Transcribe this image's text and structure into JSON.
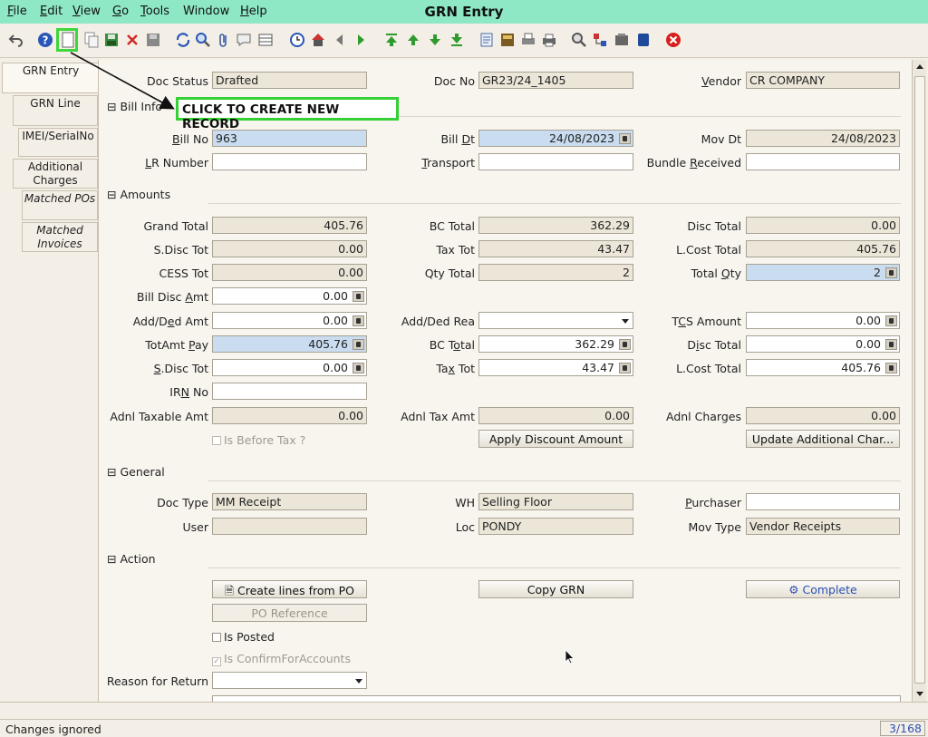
{
  "menu": {
    "items": [
      {
        "label": "File",
        "u": "F",
        "rest": "ile"
      },
      {
        "label": "Edit",
        "u": "E",
        "rest": "dit"
      },
      {
        "label": "View",
        "u": "V",
        "rest": "iew"
      },
      {
        "label": "Go",
        "u": "G",
        "rest": "o"
      },
      {
        "label": "Tools",
        "u": "T",
        "rest": "ools"
      },
      {
        "label": "Window",
        "u": "",
        "rest": "Window"
      },
      {
        "label": "Help",
        "u": "H",
        "rest": "elp"
      }
    ],
    "title": "GRN Entry"
  },
  "annotation": {
    "callout": "CLICK TO CREATE NEW RECORD"
  },
  "tabs": [
    {
      "label": "GRN Entry"
    },
    {
      "label": "GRN Line"
    },
    {
      "label": "IMEI/SerialNo"
    },
    {
      "label": "Additional Charges"
    },
    {
      "label": "Matched POs"
    },
    {
      "label": "Matched Invoices"
    }
  ],
  "header": {
    "doc_status_label": "Doc Status",
    "doc_status": "Drafted",
    "doc_no_label": "Doc No",
    "doc_no": "GR23/24_1405",
    "vendor_label_u": "V",
    "vendor_label_rest": "endor",
    "vendor": "CR COMPANY"
  },
  "bill_info": {
    "title": "Bill Info",
    "bill_no_label_u": "B",
    "bill_no_label_rest": "ill No",
    "bill_no": "963",
    "bill_dt_label_pre": "Bill ",
    "bill_dt_label_u": "D",
    "bill_dt_label_rest": "t",
    "bill_dt": "24/08/2023",
    "mov_dt_label": "Mov Dt",
    "mov_dt": "24/08/2023",
    "lr_label_u": "L",
    "lr_label_rest": "R Number",
    "lr_number": "",
    "transport_label_u": "T",
    "transport_label_rest": "ransport",
    "transport": "",
    "bundle_label_pre": "Bundle ",
    "bundle_label_u": "R",
    "bundle_label_rest": "eceived",
    "bundle_received": ""
  },
  "amounts": {
    "title": "Amounts",
    "grand_total_label": "Grand Total",
    "grand_total": "405.76",
    "bc_total_label": "BC Total",
    "bc_total": "362.29",
    "disc_total_label": "Disc Total",
    "disc_total": "0.00",
    "sdisc_tot_label": "S.Disc Tot",
    "sdisc_tot": "0.00",
    "tax_tot_label": "Tax Tot",
    "tax_tot": "43.47",
    "lcost_total_label": "L.Cost Total",
    "lcost_total": "405.76",
    "cess_tot_label": "CESS Tot",
    "cess_tot": "0.00",
    "qty_total_label": "Qty Total",
    "qty_total": "2",
    "total_qty_label_pre": "Total ",
    "total_qty_label_u": "Q",
    "total_qty_label_rest": "ty",
    "total_qty": "2",
    "bill_disc_amt_label_pre": "Bill Disc ",
    "bill_disc_amt_label_u": "A",
    "bill_disc_amt_label_rest": "mt",
    "bill_disc_amt": "0.00",
    "add_ded_amt_label_pre": "Add/D",
    "add_ded_amt_label_u": "e",
    "add_ded_amt_label_rest": "d Amt",
    "add_ded_amt": "0.00",
    "add_ded_rea_label": "Add/Ded Rea",
    "add_ded_rea": "",
    "tcs_amount_label_pre": "T",
    "tcs_amount_label_u": "C",
    "tcs_amount_label_rest": "S Amount",
    "tcs_amount": "0.00",
    "totamt_pay_label_pre": "TotAmt ",
    "totamt_pay_label_u": "P",
    "totamt_pay_label_rest": "ay",
    "totamt_pay": "405.76",
    "bc_total2_label_pre": "BC T",
    "bc_total2_label_u": "o",
    "bc_total2_label_rest": "tal",
    "bc_total2": "362.29",
    "disc_total2_label_pre": "D",
    "disc_total2_label_u": "i",
    "disc_total2_label_rest": "sc Total",
    "disc_total2": "0.00",
    "sdisc_tot2_label_u": "S",
    "sdisc_tot2_label_rest": ".Disc Tot",
    "sdisc_tot2": "0.00",
    "tax_tot2_label_pre": "Ta",
    "tax_tot2_label_u": "x",
    "tax_tot2_label_rest": " Tot",
    "tax_tot2": "43.47",
    "lcost_total2_label": "L.Cost Total",
    "lcost_total2": "405.76",
    "irn_label_pre": "IR",
    "irn_label_u": "N",
    "irn_label_rest": " No",
    "irn_no": "",
    "adnl_taxable_label": "Adnl Taxable Amt",
    "adnl_taxable": "0.00",
    "adnl_tax_label": "Adnl Tax Amt",
    "adnl_tax": "0.00",
    "adnl_charges_label": "Adnl Charges",
    "adnl_charges": "0.00",
    "is_before_tax_label": "Is Before Tax ?",
    "apply_discount_label": "Apply Discount Amount",
    "update_additional_label": "Update Additional Char..."
  },
  "general": {
    "title": "General",
    "doc_type_label": "Doc Type",
    "doc_type": "MM Receipt",
    "wh_label": "WH",
    "wh": "Selling Floor",
    "purchaser_label_u": "P",
    "purchaser_label_rest": "urchaser",
    "purchaser": "",
    "user_label": "User",
    "user": "",
    "loc_label": "Loc",
    "loc": "PONDY",
    "mov_type_label": "Mov Type",
    "mov_type": "Vendor Receipts"
  },
  "action": {
    "title": "Action",
    "create_lines_label": "Create lines from PO",
    "copy_grn_label": "Copy GRN",
    "complete_label": "Complete",
    "po_reference_label": "PO Reference",
    "is_posted_label": "Is Posted",
    "is_confirm_label": "Is ConfirmForAccounts",
    "reason_label": "Reason for Return",
    "reason": ""
  },
  "status": {
    "message": "Changes ignored",
    "record": "3/168"
  },
  "colors": {
    "menubar": "#8ee8c6",
    "highlight": "#35d035",
    "readonly": "#ebe6d8",
    "mandatory": "#c9dcf0"
  }
}
